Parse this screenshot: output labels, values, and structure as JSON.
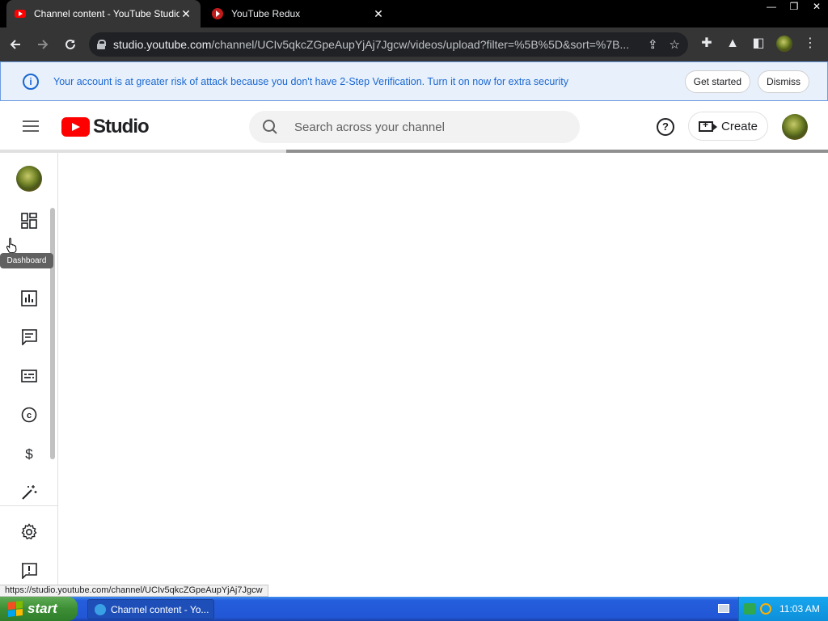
{
  "browser": {
    "tabs": [
      {
        "title": "Channel content - YouTube Studio",
        "close": "✕"
      },
      {
        "title": "YouTube Redux",
        "close": "✕"
      }
    ],
    "window_controls": {
      "minimize": "—",
      "restore": "❐",
      "close": "✕"
    },
    "url_domain": "studio.youtube.com",
    "url_path": "/channel/UCIv5qkcZGpeAupYjAj7Jgcw/videos/upload?filter=%5B%5D&sort=%7B..."
  },
  "banner": {
    "icon": "info-icon",
    "message": "Your account is at greater risk of attack because you don't have 2-Step Verification. Turn it on now for extra security",
    "primary_button": "Get started",
    "secondary_button": "Dismiss"
  },
  "header": {
    "logo_text": "Studio",
    "search_placeholder": "Search across your channel",
    "help_glyph": "?",
    "create_label": "Create"
  },
  "loading_progress": 0.35,
  "sidenav": {
    "items": [
      {
        "name": "dashboard",
        "icon": "dashboard-icon"
      },
      {
        "name": "analytics",
        "icon": "analytics-icon"
      },
      {
        "name": "comments",
        "icon": "comments-icon"
      },
      {
        "name": "subtitles",
        "icon": "subtitles-icon"
      },
      {
        "name": "copyright",
        "icon": "copyright-icon"
      },
      {
        "name": "earn",
        "icon": "monetization-icon"
      },
      {
        "name": "customization",
        "icon": "magic-wand-icon"
      },
      {
        "name": "settings",
        "icon": "gear-icon"
      },
      {
        "name": "feedback",
        "icon": "feedback-icon"
      }
    ],
    "tooltip": "Dashboard",
    "copyright_glyph": "c",
    "earn_glyph": "$"
  },
  "status_url": "https://studio.youtube.com/channel/UCIv5qkcZGpeAupYjAj7Jgcw",
  "taskbar": {
    "start_label": "start",
    "task_label": "Channel content - Yo...",
    "clock": "11:03 AM"
  },
  "colors": {
    "accent_blue": "#1a67d2",
    "youtube_red": "#ff0000",
    "banner_bg": "#e8f1fb"
  }
}
